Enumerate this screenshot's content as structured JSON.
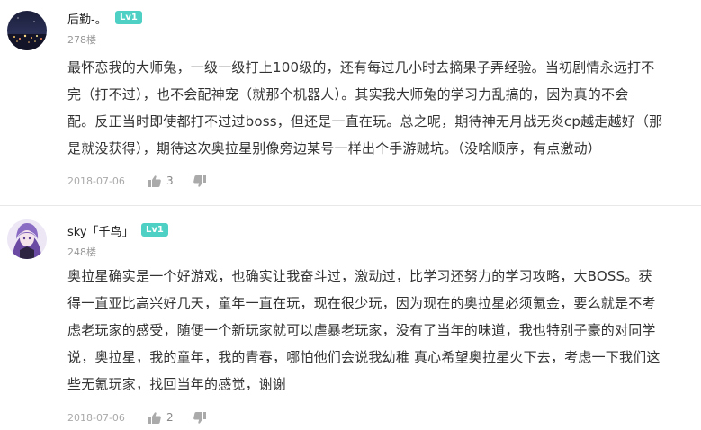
{
  "comments": [
    {
      "username": "后勤-。",
      "level": "Lv1",
      "floor": "278楼",
      "lines": [
        "最怀恋我的大师兔，一级一级打上100级的，还有每过几小时去摘果子弄经验。当初剧情永远打不",
        "完（打不过），也不会配神宠（就那个机器人）。其实我大师兔的学习力乱搞的，因为真的不会",
        "配。反正当时即使都打不过过boss，但还是一直在玩。总之呢，期待神无月战无炎cp越走越好（那",
        "是就没获得），期待这次奥拉星别像旁边某号一样出个手游贼坑。（没啥顺序，有点激动）"
      ],
      "date": "2018-07-06",
      "likes": "3",
      "avatar_icon": "night-city-avatar-icon"
    },
    {
      "username": "sky「千鸟」",
      "level": "Lv1",
      "floor": "248楼",
      "lines": [
        "奥拉星确实是一个好游戏，也确实让我奋斗过，激动过，比学习还努力的学习攻略，大BOSS。获",
        "得一直亚比高兴好几天，童年一直在玩，现在很少玩，因为现在的奥拉星必须氪金，要么就是不考",
        "虑老玩家的感受，随便一个新玩家就可以虐暴老玩家，没有了当年的味道，我也特别子豪的对同学",
        "说，奥拉星，我的童年，我的青春，哪怕他们会说我幼稚 真心希望奥拉星火下去，考虑一下我们这",
        "些无氪玩家，找回当年的感觉，谢谢"
      ],
      "date": "2018-07-06",
      "likes": "2",
      "avatar_icon": "anime-character-avatar-icon"
    }
  ],
  "colors": {
    "level_badge": "#4fd0c4",
    "body_text": "#333333",
    "meta_text": "#aaaaaa",
    "divider": "#e8e8e8"
  }
}
